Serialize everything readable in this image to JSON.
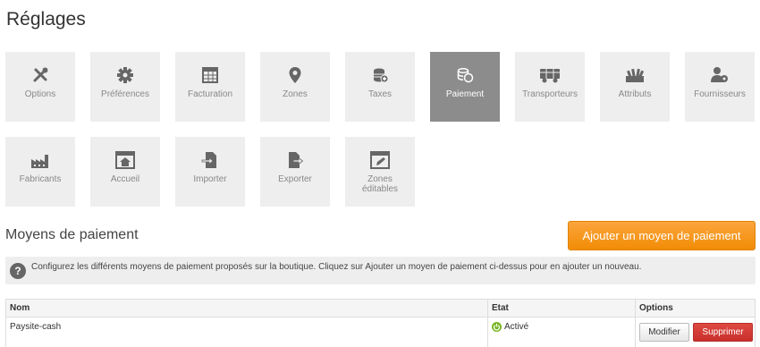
{
  "page": {
    "title": "Réglages"
  },
  "tiles": [
    {
      "label": "Options",
      "icon": "tools-icon",
      "active": false
    },
    {
      "label": "Préférences",
      "icon": "gear-icon",
      "active": false
    },
    {
      "label": "Facturation",
      "icon": "invoice-icon",
      "active": false
    },
    {
      "label": "Zones",
      "icon": "map-pin-icon",
      "active": false
    },
    {
      "label": "Taxes",
      "icon": "coins-plus-icon",
      "active": false
    },
    {
      "label": "Paiement",
      "icon": "coins-icon",
      "active": true
    },
    {
      "label": "Transporteurs",
      "icon": "truck-icon",
      "active": false
    },
    {
      "label": "Attributs",
      "icon": "swatches-icon",
      "active": false
    },
    {
      "label": "Fournisseurs",
      "icon": "user-gear-icon",
      "active": false
    },
    {
      "label": "Fabricants",
      "icon": "factory-icon",
      "active": false
    },
    {
      "label": "Accueil",
      "icon": "home-window-icon",
      "active": false
    },
    {
      "label": "Importer",
      "icon": "file-import-icon",
      "active": false
    },
    {
      "label": "Exporter",
      "icon": "file-export-icon",
      "active": false
    },
    {
      "label": "Zones\néditables",
      "icon": "edit-window-icon",
      "active": false
    }
  ],
  "section": {
    "title": "Moyens de paiement",
    "add_button": "Ajouter un moyen de paiement",
    "help_text": "Configurez les différents moyens de paiement proposés sur la boutique. Cliquez sur Ajouter un moyen de paiement ci-dessus pour en ajouter un nouveau."
  },
  "table": {
    "headers": {
      "name": "Nom",
      "status": "Etat",
      "options": "Options"
    },
    "rows": [
      {
        "name": "Paysite-cash",
        "status": "Activé",
        "edit_label": "Modifier",
        "delete_label": "Supprimer"
      }
    ]
  },
  "colors": {
    "accent": "#f28c06",
    "active_tile": "#8c8c8c",
    "danger": "#c9302c",
    "status_active": "#77b522"
  }
}
